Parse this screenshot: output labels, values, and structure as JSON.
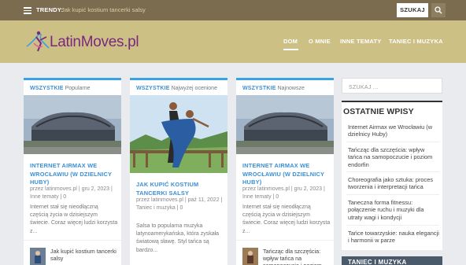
{
  "topbar": {
    "trendy_label": "TRENDY:",
    "trendy_text": "Jak kupić kostium tancerki salsy",
    "search_label": "SZUKAJ",
    "menu_icon": "hamburger-icon",
    "search_icon": "magnifier-icon"
  },
  "header": {
    "logo_text_main": "LatinMoves",
    "logo_text_suffix": ".pl",
    "nav": [
      "DOM",
      "O MNIE",
      "INNE TEMATY",
      "TANIEC I MUZYKA"
    ],
    "active_nav": "DOM"
  },
  "cards": [
    {
      "category": "WSZYSTKIE",
      "sort": "Popularne",
      "title": "INTERNET AIRMAX WE WROCŁAWIU (W DZIELNICY HUBY)",
      "meta": "przez latinmoves.pl | gru 2, 2023 | Inne tematy | 0",
      "excerpt": "Internet stał się nieodłączną częścią życia w dzisiejszym świecie. Coraz więcej ludzi korzysta z...",
      "related_title": "Jak kupić kostium tancerki salsy"
    },
    {
      "category": "WSZYSTKIE",
      "sort": "Najwyżej ocenione",
      "title": "JAK KUPIĆ KOSTIUM TANCERKI SALSY",
      "meta": "przez latinmoves.pl | paź 11, 2022 | Taniec i muzyka | 0",
      "excerpt": "Salsa to popularna muzyka latynoamerykańska, która zyskała światową sławę. Styl tańca są bardzo..."
    },
    {
      "category": "WSZYSTKIE",
      "sort": "Najnowsze",
      "title": "INTERNET AIRMAX WE WROCŁAWIU (W DZIELNICY HUBY)",
      "meta": "przez latinmoves.pl | gru 2, 2023 | Inne tematy | 0",
      "excerpt": "Internet stał się nieodłączną częścią życia w dzisiejszym świecie. Coraz więcej ludzi korzysta z...",
      "related_title": "Tańcząc dla szczęścia: wpływ tańca na samopoczucie i poziom endorfin"
    }
  ],
  "sidebar": {
    "search_placeholder": "SZUKAJ ...",
    "recent_title": "OSTATNIE WPISY",
    "recent": [
      "Internet Airmax we Wrocławiu (w dzielnicy Huby)",
      "Tańcząc dla szczęścia: wpływ tańca na samopoczucie i poziom endorfin",
      "Choreografia jako sztuka: proces tworzenia i interpretacji tańca",
      "Taneczna forma fitnessu: połączenie ruchu i muzyki dla utraty wagi i kondycji",
      "Tańce towarzyskie: nauka elegancji i harmonii w parze"
    ],
    "widget2_title": "TANIEC I MUZYKA"
  },
  "colors": {
    "topbar": "#7b6b4f",
    "header": "#cdc085",
    "accent": "#3aa3e3",
    "logo": "#7a2880"
  }
}
